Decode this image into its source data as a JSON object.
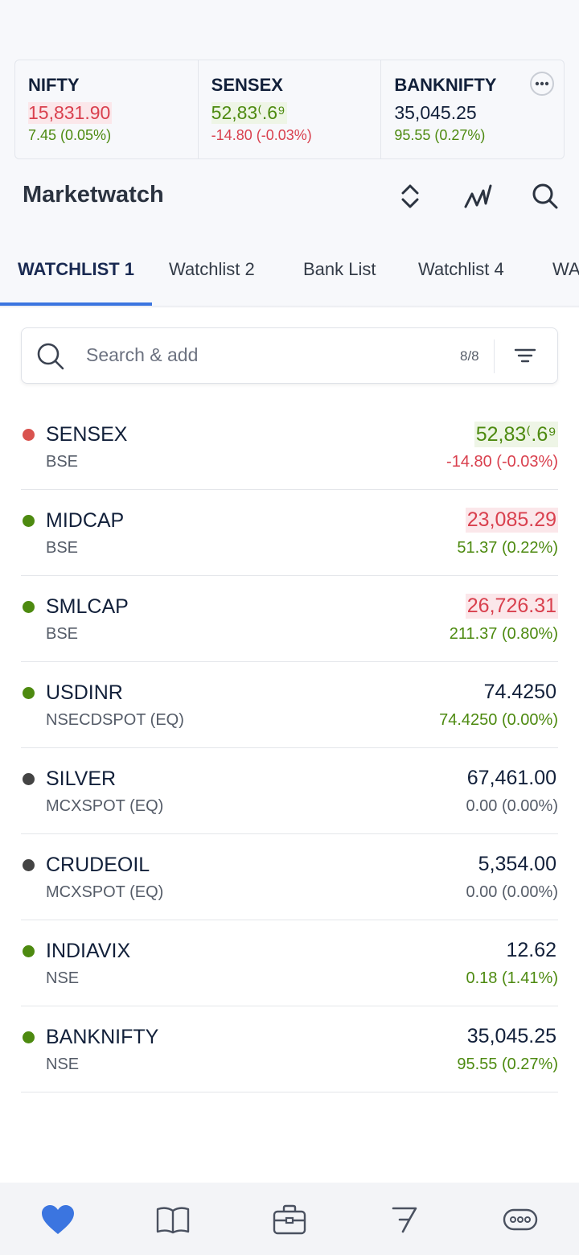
{
  "ticker": [
    {
      "name": "NIFTY",
      "value": "15,831.90",
      "change": "7.45 (0.05%)",
      "value_style": "red-hl",
      "change_color": "green"
    },
    {
      "name": "SENSEX",
      "value": "52,83⁽.6⁹",
      "change": "-14.80 (-0.03%)",
      "value_style": "green-hl",
      "change_color": "red"
    },
    {
      "name": "BANKNIFTY",
      "value": "35,045.25",
      "change": "95.55 (0.27%)",
      "value_style": "plain",
      "change_color": "green"
    }
  ],
  "header": {
    "title": "Marketwatch"
  },
  "tabs": [
    "WATCHLIST 1",
    "Watchlist 2",
    "Bank List",
    "Watchlist 4",
    "WA"
  ],
  "search": {
    "placeholder": "Search & add",
    "count": "8/8"
  },
  "rows": [
    {
      "symbol": "SENSEX",
      "exchange": "BSE",
      "ltp": "52,83⁽.6⁹",
      "change": "-14.80 (-0.03%)",
      "dot": "#d9534f",
      "ltp_style": "hl-green",
      "change_color": "red"
    },
    {
      "symbol": "MIDCAP",
      "exchange": "BSE",
      "ltp": "23,085.29",
      "change": "51.37 (0.22%)",
      "dot": "#4d8a10",
      "ltp_style": "hl-red",
      "change_color": "green"
    },
    {
      "symbol": "SMLCAP",
      "exchange": "BSE",
      "ltp": "26,726.31",
      "change": "211.37 (0.80%)",
      "dot": "#4d8a10",
      "ltp_style": "hl-red",
      "change_color": "green"
    },
    {
      "symbol": "USDINR",
      "exchange": "NSECDSPOT (EQ)",
      "ltp": "74.4250",
      "change": "74.4250 (0.00%)",
      "dot": "#4d8a10",
      "ltp_style": "plain",
      "change_color": "green"
    },
    {
      "symbol": "SILVER",
      "exchange": "MCXSPOT (EQ)",
      "ltp": "67,461.00",
      "change": "0.00 (0.00%)",
      "dot": "#444444",
      "ltp_style": "plain",
      "change_color": "grey"
    },
    {
      "symbol": "CRUDEOIL",
      "exchange": "MCXSPOT (EQ)",
      "ltp": "5,354.00",
      "change": "0.00 (0.00%)",
      "dot": "#444444",
      "ltp_style": "plain",
      "change_color": "grey"
    },
    {
      "symbol": "INDIAVIX",
      "exchange": "NSE",
      "ltp": "12.62",
      "change": "0.18 (1.41%)",
      "dot": "#4d8a10",
      "ltp_style": "plain",
      "change_color": "green"
    },
    {
      "symbol": "BANKNIFTY",
      "exchange": "NSE",
      "ltp": "35,045.25",
      "change": "95.55 (0.27%)",
      "dot": "#4d8a10",
      "ltp_style": "plain",
      "change_color": "green"
    }
  ],
  "bottom_nav": [
    {
      "icon": "heart-icon",
      "active": true
    },
    {
      "icon": "book-icon",
      "active": false
    },
    {
      "icon": "briefcase-icon",
      "active": false
    },
    {
      "icon": "flag-icon",
      "active": false
    },
    {
      "icon": "more-icon",
      "active": false
    }
  ],
  "colors": {
    "accent": "#3b75e0",
    "green": "#4d8a10",
    "red": "#d9404e"
  }
}
